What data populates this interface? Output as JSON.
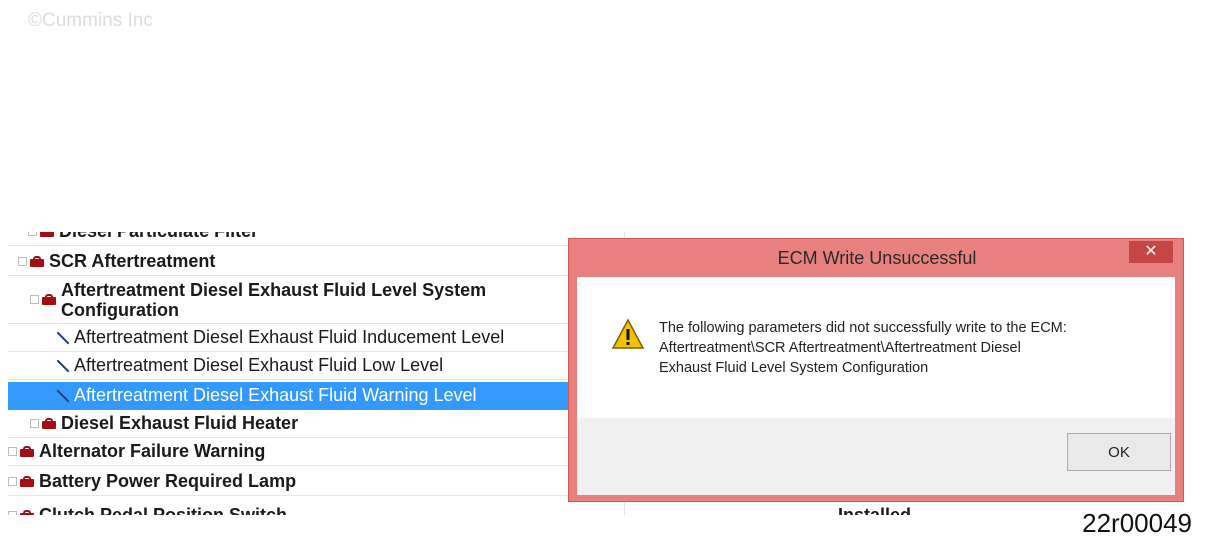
{
  "copyright": "©Cummins Inc",
  "figure_id": "22r00049",
  "tree": {
    "rows": [
      {
        "label": "Diesel Particulate Filter",
        "kind": "folder",
        "bold": true,
        "selected": false,
        "expander": true
      },
      {
        "label": "SCR Aftertreatment",
        "kind": "folder",
        "bold": true,
        "selected": false,
        "expander": true
      },
      {
        "label": "Aftertreatment Diesel Exhaust Fluid Level System Configuration",
        "kind": "folder",
        "bold": true,
        "selected": false,
        "expander": true
      },
      {
        "label": "Aftertreatment Diesel Exhaust Fluid Inducement Level",
        "kind": "param",
        "bold": false,
        "selected": false,
        "expander": false
      },
      {
        "label": "Aftertreatment Diesel Exhaust Fluid Low Level",
        "kind": "param",
        "bold": false,
        "selected": false,
        "expander": false
      },
      {
        "label": "Aftertreatment Diesel Exhaust Fluid Warning Level",
        "kind": "param",
        "bold": false,
        "selected": true,
        "expander": false
      },
      {
        "label": "Diesel Exhaust Fluid Heater",
        "kind": "folder",
        "bold": true,
        "selected": false,
        "expander": true
      },
      {
        "label": "Alternator Failure Warning",
        "kind": "folder",
        "bold": true,
        "selected": false,
        "expander": true
      },
      {
        "label": "Battery Power Required Lamp",
        "kind": "folder",
        "bold": true,
        "selected": false,
        "expander": true
      },
      {
        "label": "Clutch Pedal Position Switch",
        "kind": "folder",
        "bold": true,
        "selected": false,
        "expander": true
      }
    ],
    "clutch_value": "Installed"
  },
  "dialog": {
    "title": "ECM Write Unsuccessful",
    "close_symbol": "✕",
    "message_line1": "The following parameters did not successfully write to the ECM:",
    "message_line2": "Aftertreatment\\SCR Aftertreatment\\Aftertreatment Diesel",
    "message_line3": "Exhaust Fluid Level System Configuration",
    "ok_label": "OK",
    "warning_icon": "warning-triangle-icon"
  },
  "colors": {
    "selection": "#3399ff",
    "folder_icon": "#a10f14",
    "dialog_frame": "#e98080",
    "close_button": "#c64545"
  }
}
